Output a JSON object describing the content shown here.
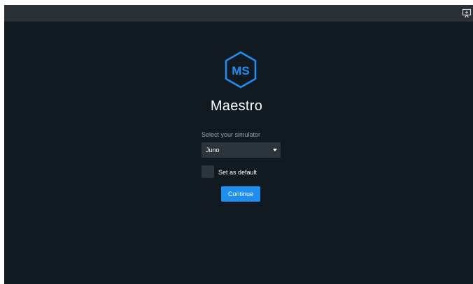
{
  "app": {
    "logo_text": "MS",
    "title": "Maestro"
  },
  "titlebar": {
    "present_icon": "present-to-screen-icon"
  },
  "simulator": {
    "label": "Select your simulator",
    "selected": "Juno"
  },
  "default_checkbox": {
    "label": "Set as default",
    "checked": false
  },
  "continue_button": {
    "label": "Continue"
  },
  "colors": {
    "background": "#111a21",
    "titlebar": "#2a3036",
    "accent": "#1f8ef1",
    "logo": "#1f8ef1",
    "control_bg": "#2d353c"
  }
}
